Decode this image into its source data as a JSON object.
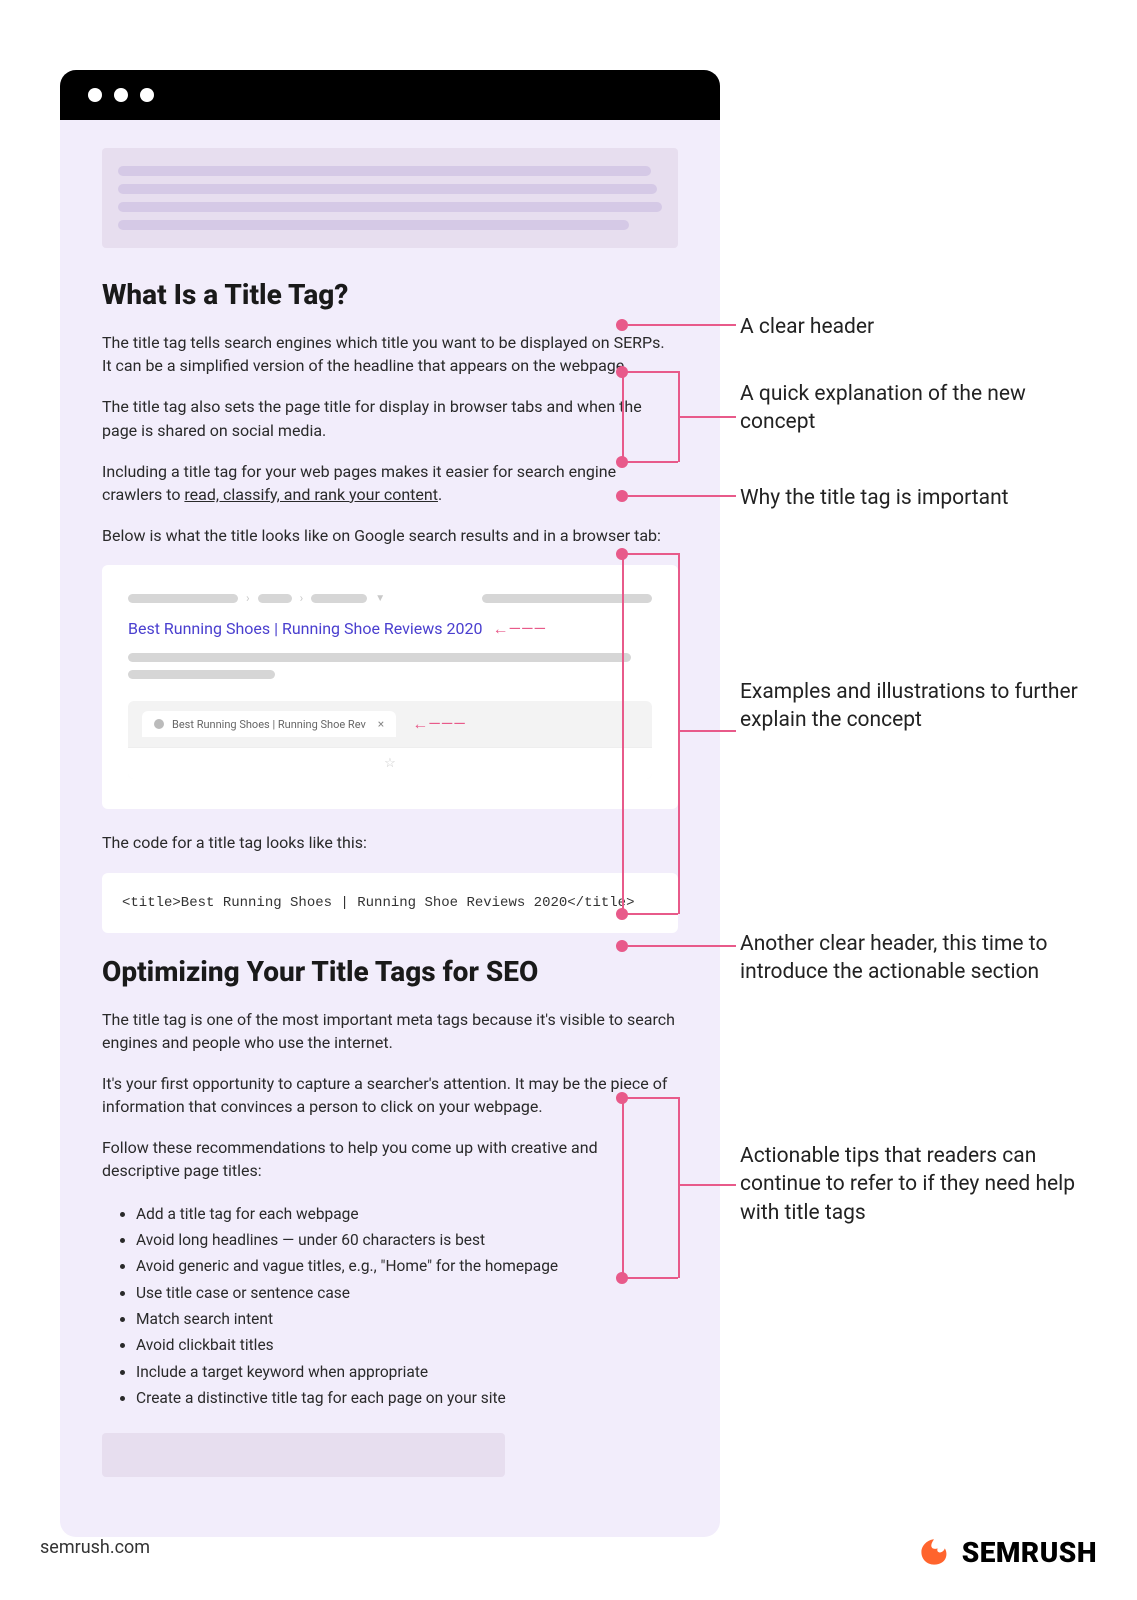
{
  "headings": {
    "h1": "What Is a Title Tag?",
    "h2": "Optimizing Your Title Tags for SEO"
  },
  "paragraphs": {
    "p1": "The title tag tells search engines which title you want to be displayed on SERPs. It can be a simplified version of the headline that appears on the webpage.",
    "p2": "The title tag also sets the page title for display in browser tabs and when the page is shared on social media.",
    "p3_a": "Including a title tag for your web pages makes it easier for search engine crawlers to ",
    "p3_link": "read, classify, and rank your content",
    "p3_b": ".",
    "p4": "Below is what the title looks like on Google search results and in a browser tab:",
    "p5": "The code for a title tag looks like this:",
    "p6": "The title tag is one of the most important meta tags because it's visible to search engines and people who use the internet.",
    "p7": "It's your first opportunity to capture a searcher's attention. It may be the piece of information that convinces a person to click on your webpage.",
    "p8": "Follow these recommendations to help you come up with creative and descriptive page titles:"
  },
  "example": {
    "serp_title": "Best Running Shoes | Running Shoe Reviews 2020",
    "tab_text": "Best Running Shoes | Running Shoe Rev",
    "code": "<title>Best Running Shoes | Running Shoe Reviews 2020</title>"
  },
  "tips": [
    "Add a title tag for each webpage",
    "Avoid long headlines — under 60 characters is best",
    "Avoid generic and vague titles, e.g., \"Home\" for the homepage",
    "Use title case or sentence case",
    "Match search intent",
    "Avoid clickbait titles",
    "Include a target keyword when appropriate",
    "Create a distinctive title tag for each page on your site"
  ],
  "annotations": {
    "a1": "A clear header",
    "a2": "A quick explanation of the new concept",
    "a3": "Why the title tag is important",
    "a4": "Examples and illustrations to further explain the concept",
    "a5": "Another clear header, this time to introduce the actionable section",
    "a6": "Actionable tips that readers can continue to refer to if they need help with title tags"
  },
  "footer": {
    "domain": "semrush.com",
    "brand": "SEMRUSH"
  }
}
